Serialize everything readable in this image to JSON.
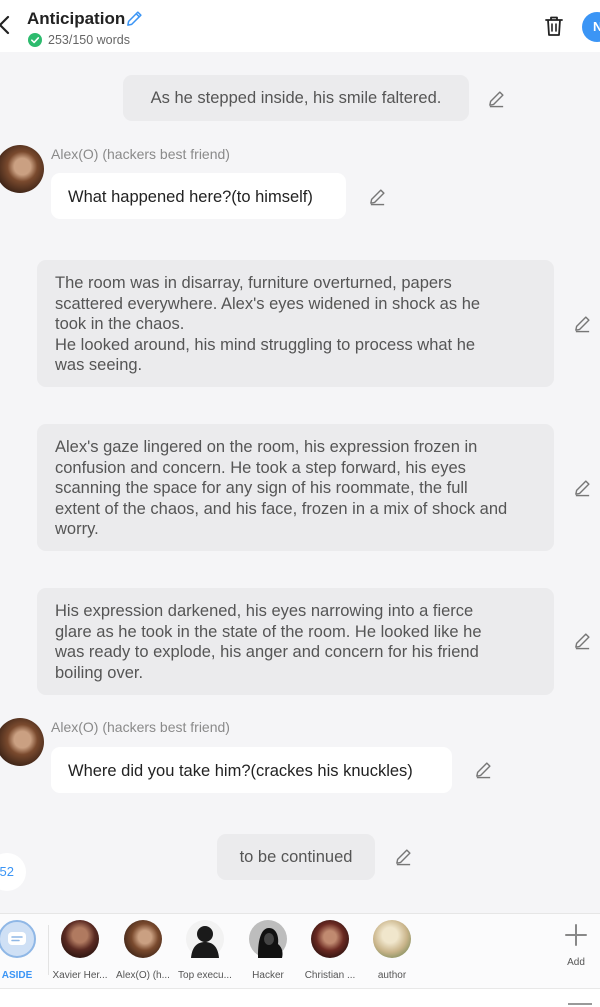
{
  "header": {
    "title": "Anticipation",
    "word_count": "253/150 words",
    "user_initial": "N"
  },
  "messages": [
    {
      "type": "narration",
      "text": "As he stepped inside, his smile faltered."
    },
    {
      "type": "dialogue",
      "speaker": "Alex(O) (hackers best friend)",
      "text": "What happened here?(to himself)"
    },
    {
      "type": "narration",
      "lines": [
        "The room was in disarray, furniture overturned, papers",
        "scattered everywhere. Alex's eyes widened in shock as he",
        "took in the chaos.",
        "He looked around, his mind struggling to process what he",
        "was seeing."
      ]
    },
    {
      "type": "narration",
      "lines": [
        "Alex's gaze lingered on the room, his expression frozen in",
        "confusion and concern. He took a step forward, his eyes",
        "scanning the space for any sign of his roommate, the full",
        "extent of the chaos, and his face, frozen in a mix of shock and",
        "worry."
      ]
    },
    {
      "type": "narration",
      "lines": [
        "His expression darkened, his eyes narrowing into a fierce",
        "glare as he took in the state of the room. He looked like he",
        "was ready to explode, his anger and concern for his friend",
        "boiling over."
      ]
    },
    {
      "type": "dialogue",
      "speaker": "Alex(O) (hackers best friend)",
      "text": "Where did you take him?(crackes his knuckles)"
    },
    {
      "type": "narration",
      "text": "to be continued"
    }
  ],
  "page_indicator": "52",
  "characters": [
    {
      "name": "ASIDE",
      "icon": "aside-chat-icon"
    },
    {
      "name": "Xavier Her...",
      "color": "#5a2a22"
    },
    {
      "name": "Alex(O) (h...",
      "color": "#7a4a2e"
    },
    {
      "name": "Top execu...",
      "icon": "silhouette-icon"
    },
    {
      "name": "Hacker",
      "icon": "hooded-silhouette-icon"
    },
    {
      "name": "Christian ...",
      "color": "#6b2a22"
    },
    {
      "name": "author",
      "color": "#c9b48a"
    }
  ],
  "add_label": "Add",
  "icons": {
    "back": "chevron-left-icon",
    "edit": "pencil-icon",
    "delete": "trash-icon",
    "status": "check-circle-icon",
    "add": "plus-icon"
  },
  "colors": {
    "accent": "#3b95f5",
    "status_green": "#2dbb6e",
    "narration_bg": "#ebebed",
    "dialogue_bg": "#ffffff"
  }
}
